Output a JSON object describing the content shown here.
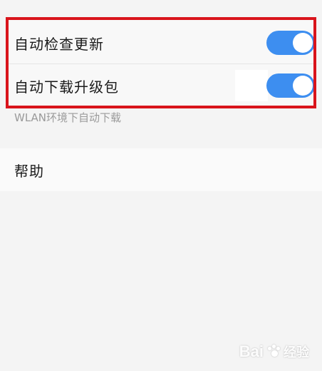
{
  "settings": {
    "auto_check": {
      "label": "自动检查更新",
      "enabled": true
    },
    "auto_download": {
      "label": "自动下载升级包",
      "enabled": true
    },
    "hint": "WLAN环境下自动下载"
  },
  "help": {
    "label": "帮助"
  },
  "colors": {
    "toggle_on": "#3d8ef0",
    "highlight": "#d9141b",
    "background": "#f4f4f4"
  },
  "watermark": {
    "brand_left": "Bai",
    "brand_right": "经验"
  }
}
